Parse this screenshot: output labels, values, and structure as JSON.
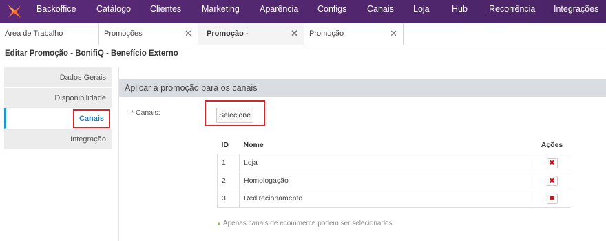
{
  "nav": {
    "items": [
      "Backoffice",
      "Catálogo",
      "Clientes",
      "Marketing",
      "Aparência",
      "Configs",
      "Canais",
      "Loja",
      "Hub",
      "Recorrência",
      "Integrações"
    ]
  },
  "tabs": [
    {
      "label": "Área de Trabalho",
      "close": ""
    },
    {
      "label": "Promoções",
      "close": "✕"
    },
    {
      "label": "Promoção -",
      "close": "✕"
    },
    {
      "label": "Promoção",
      "close": "✕"
    }
  ],
  "page_title": "Editar Promoção - BonifiQ - Benefício Externo",
  "sidebar": {
    "items": [
      "Dados Gerais",
      "Disponibilidade",
      "Canais",
      "Integração"
    ]
  },
  "section": {
    "title": "Aplicar a promoção para os canais",
    "field_label": "* Canais:",
    "select_button": "Selecione"
  },
  "table": {
    "headers": {
      "id": "ID",
      "name": "Nome",
      "actions": "Ações"
    },
    "rows": [
      {
        "id": "1",
        "name": "Loja"
      },
      {
        "id": "2",
        "name": "Homologação"
      },
      {
        "id": "3",
        "name": "Redirecionamento"
      }
    ],
    "delete_glyph": "✖"
  },
  "note": "Apenas canais de ecommerce podem ser selecionados.",
  "colors": {
    "nav_bg": "#5a2a78",
    "accent": "#1e7fc0",
    "highlight": "#d6262c",
    "delete": "#c0161b"
  }
}
